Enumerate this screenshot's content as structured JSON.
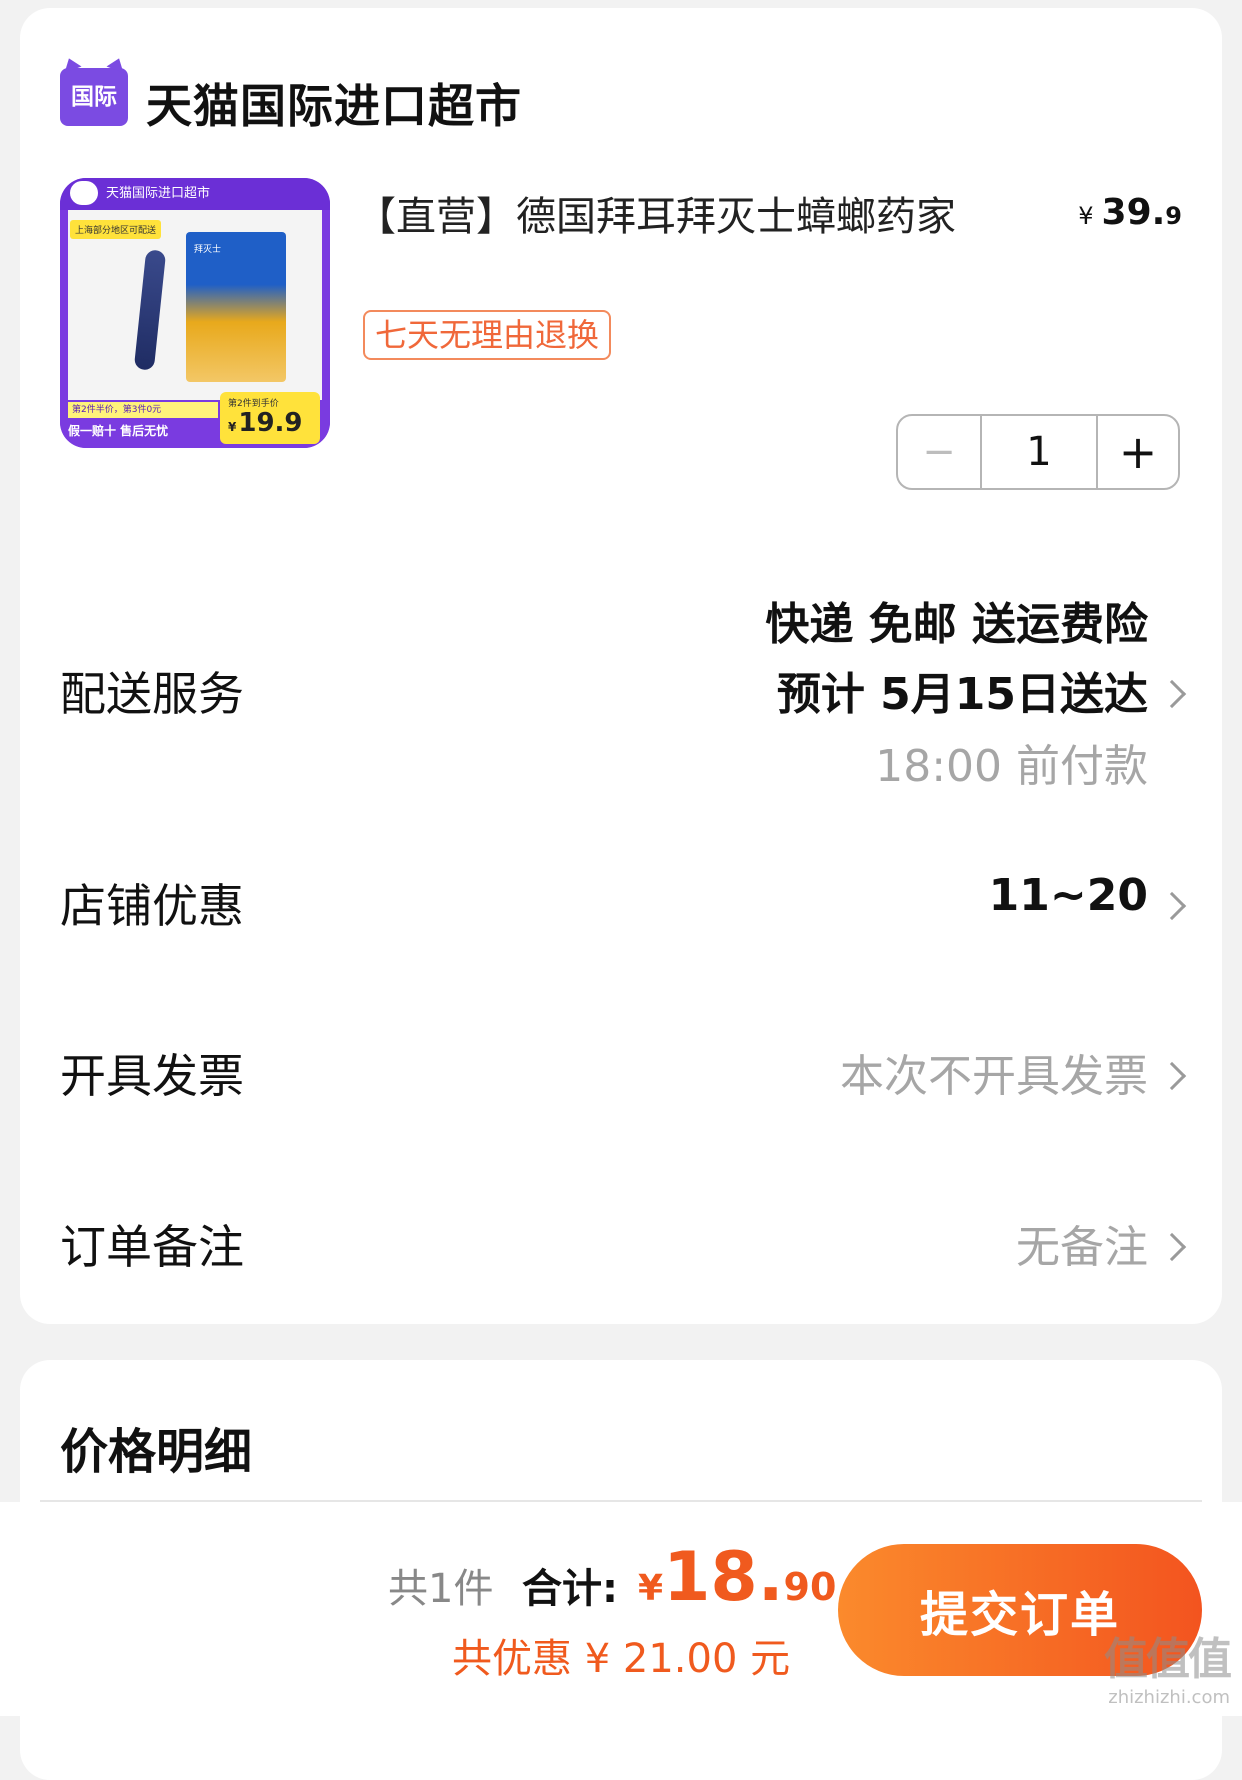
{
  "store": {
    "logo_text": "国际",
    "name": "天猫国际进口超市"
  },
  "product": {
    "image": {
      "header": "天猫国际进口超市",
      "tag": "上海部分地区可配送",
      "box_label": "拜灭士",
      "promo_line1": "第2件半价，第3件0元",
      "promo_line2": "假一赔十 售后无忧",
      "price_sub": "第2件到手价",
      "price_yen": "¥",
      "price": "19.9"
    },
    "title": "【直营】德国拜耳拜灭士蟑螂药家",
    "price_yen": "¥",
    "price_int": "39.",
    "price_dec": "9",
    "return_badge": "七天无理由退换",
    "quantity": {
      "minus": "−",
      "value": "1",
      "plus": "+"
    }
  },
  "rows": {
    "delivery": {
      "label": "配送服务",
      "line1": "快递 免邮 送运费险",
      "line2": "预计 5月15日送达",
      "line3": "18:00 前付款"
    },
    "coupon": {
      "label": "店铺优惠",
      "value": "11~20"
    },
    "invoice": {
      "label": "开具发票",
      "value": "本次不开具发票"
    },
    "note": {
      "label": "订单备注",
      "value": "无备注"
    }
  },
  "price_detail": {
    "title": "价格明细"
  },
  "bottom": {
    "count_label": "共1件",
    "total_label": "合计:",
    "total_yen": "¥",
    "total_int": "18.",
    "total_dec": "90",
    "discount_text": "共优惠 ¥ 21.00 元",
    "submit_label": "提交订单"
  },
  "watermark": {
    "big": "值值值",
    "small": "zhizhizhi.com"
  },
  "colors": {
    "accent": "#f05a1e",
    "brand_purple": "#7b4be2",
    "badge_border": "#f38a5c"
  }
}
